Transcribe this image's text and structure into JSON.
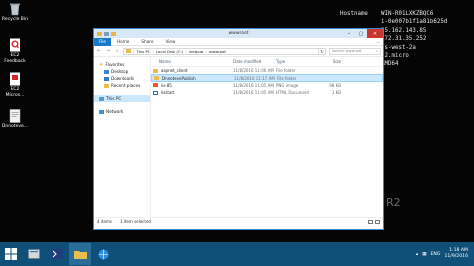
{
  "desktop": {
    "icons": [
      {
        "label": "Recycle Bin",
        "icon": "recycle-bin-icon"
      },
      {
        "label": "EC2\nFeedback",
        "icon": "ec2-feedback-icon"
      },
      {
        "label": "EC2\nMicros...",
        "icon": "ec2-microsoft-icon"
      },
      {
        "label": "Dnnoteve...",
        "icon": "shortcut-icon"
      }
    ]
  },
  "bginfo": {
    "rows": [
      {
        "k": "Hostname",
        "v": "WIN-R01LXKZBQC6"
      },
      {
        "k": "",
        "v": "i-0e007b1f1a81b625d"
      },
      {
        "k": "",
        "v": "35.162.143.85"
      },
      {
        "k": "",
        "v": "172.31.35.252"
      },
      {
        "k": "",
        "v": "us-west-2a"
      },
      {
        "k": "",
        "v": "t2.micro"
      },
      {
        "k": "",
        "v": "AMD64"
      }
    ],
    "watermark": "R2"
  },
  "window": {
    "title": "wwwroot",
    "ribbon": {
      "file": "File",
      "tabs": [
        "Home",
        "Share",
        "View"
      ]
    },
    "address": {
      "parts": [
        "This PC",
        "Local Disk (C:)",
        "inetpub",
        "wwwroot"
      ],
      "search_placeholder": "Search wwwroot"
    },
    "nav": {
      "quick_access": [
        {
          "label": "Favorites",
          "icon": "star-icon"
        },
        {
          "label": "Desktop",
          "icon": "desktop-icon"
        },
        {
          "label": "Downloads",
          "icon": "downloads-icon"
        },
        {
          "label": "Recent places",
          "icon": "recent-places-icon"
        }
      ],
      "this_pc": "This PC",
      "network": "Network"
    },
    "columns": {
      "name": "Name",
      "date": "Date modified",
      "type": "Type",
      "size": "Size"
    },
    "files": [
      {
        "name": "aspnet_client",
        "date": "11/8/2016 11:06 AM",
        "type": "File folder",
        "size": "",
        "kind": "folder",
        "selected": false
      },
      {
        "name": "DnnotevePublish",
        "date": "11/8/2016 11:17 AM",
        "type": "File folder",
        "size": "",
        "kind": "folder",
        "selected": true
      },
      {
        "name": "iis-85",
        "date": "11/8/2016 11:05 AM",
        "type": "PNG image",
        "size": "98 KB",
        "kind": "png",
        "selected": false
      },
      {
        "name": "iisstart",
        "date": "11/8/2016 11:05 AM",
        "type": "HTML Document",
        "size": "1 KB",
        "kind": "html",
        "selected": false
      }
    ],
    "status": {
      "count": "4 items",
      "selected": "1 item selected"
    }
  },
  "taskbar": {
    "apps": [
      "start-icon",
      "server-manager-icon",
      "powershell-icon",
      "file-explorer-icon",
      "browser-icon"
    ],
    "tray": {
      "lang": "ENG",
      "time": "1:18 AM",
      "date": "11/9/2016"
    }
  },
  "colors": {
    "taskbar": "#0f4f78",
    "accent": "#1979ca",
    "selection": "#cce8ff",
    "close": "#c7372f"
  }
}
